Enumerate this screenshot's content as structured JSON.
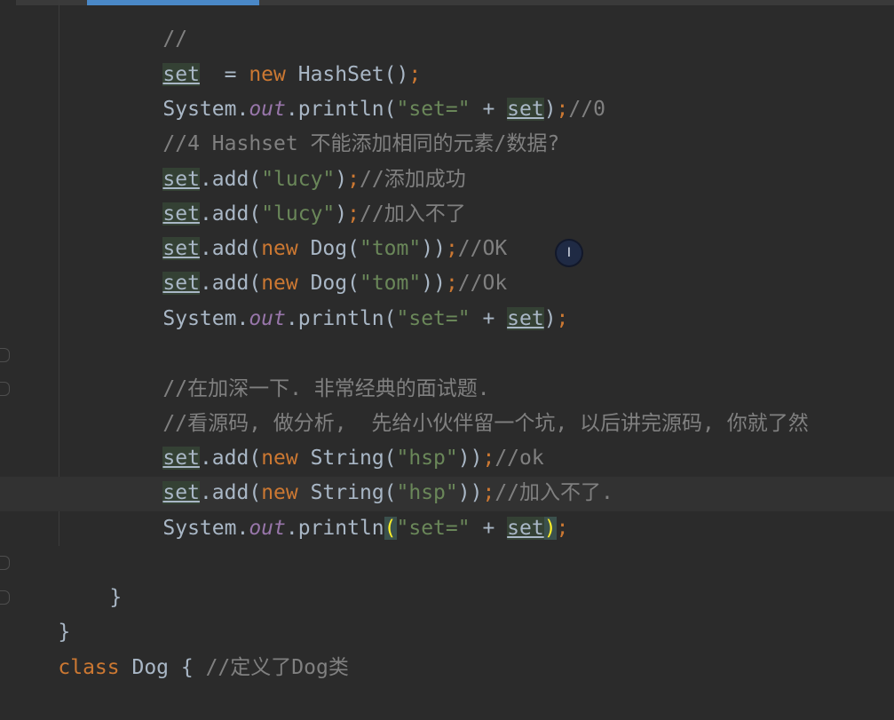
{
  "code": {
    "l1_comment": "//",
    "l2": {
      "var": "set",
      "eq": "  = ",
      "kw": "new",
      "cls": " HashSet()",
      "semi": ";"
    },
    "l3": {
      "sys": "System.",
      "field": "out",
      "call": ".println(",
      "str": "\"set=\"",
      "plus": " + ",
      "var": "set",
      "close": ")",
      "semi": ";",
      "comment": "//0"
    },
    "l4_comment": "//4 Hashset 不能添加相同的元素/数据?",
    "l5": {
      "var": "set",
      "call": ".add(",
      "str": "\"lucy\"",
      "close": ")",
      "semi": ";",
      "comment": "//添加成功"
    },
    "l6": {
      "var": "set",
      "call": ".add(",
      "str": "\"lucy\"",
      "close": ")",
      "semi": ";",
      "comment": "//加入不了"
    },
    "l7": {
      "var": "set",
      "call": ".add(",
      "kw": "new",
      "cls": " Dog(",
      "str": "\"tom\"",
      "close": "))",
      "semi": ";",
      "comment": "//OK"
    },
    "l8": {
      "var": "set",
      "call": ".add(",
      "kw": "new",
      "cls": " Dog(",
      "str": "\"tom\"",
      "close": "))",
      "semi": ";",
      "comment": "//Ok"
    },
    "l9": {
      "sys": "System.",
      "field": "out",
      "call": ".println(",
      "str": "\"set=\"",
      "plus": " + ",
      "var": "set",
      "close": ")",
      "semi": ";"
    },
    "l11_comment": "//在加深一下. 非常经典的面试题.",
    "l12_comment": "//看源码, 做分析,  先给小伙伴留一个坑, 以后讲完源码, 你就了然",
    "l13": {
      "var": "set",
      "call": ".add(",
      "kw": "new",
      "cls": " String(",
      "str": "\"hsp\"",
      "close": "))",
      "semi": ";",
      "comment": "//ok"
    },
    "l14": {
      "var": "set",
      "call": ".add(",
      "kw": "new",
      "cls": " String(",
      "str": "\"hsp\"",
      "close": "))",
      "semi": ";",
      "comment": "//加入不了."
    },
    "l15": {
      "sys": "System.",
      "field": "out",
      "call": ".println",
      "open": "(",
      "str": "\"set=\"",
      "plus": " + ",
      "var": "set",
      "close": ")",
      "semi": ";"
    },
    "l17_brace": "}",
    "l18_brace": "}",
    "l19": {
      "kw": "class",
      "name": " Dog { ",
      "comment": "//定义了Dog类"
    }
  },
  "cursor": {
    "glyph": "I"
  },
  "colors": {
    "background": "#2b2b2b",
    "keyword": "#cc7832",
    "string": "#6a8759",
    "comment": "#808080",
    "field": "#9876aa",
    "text": "#a9b7c6"
  }
}
